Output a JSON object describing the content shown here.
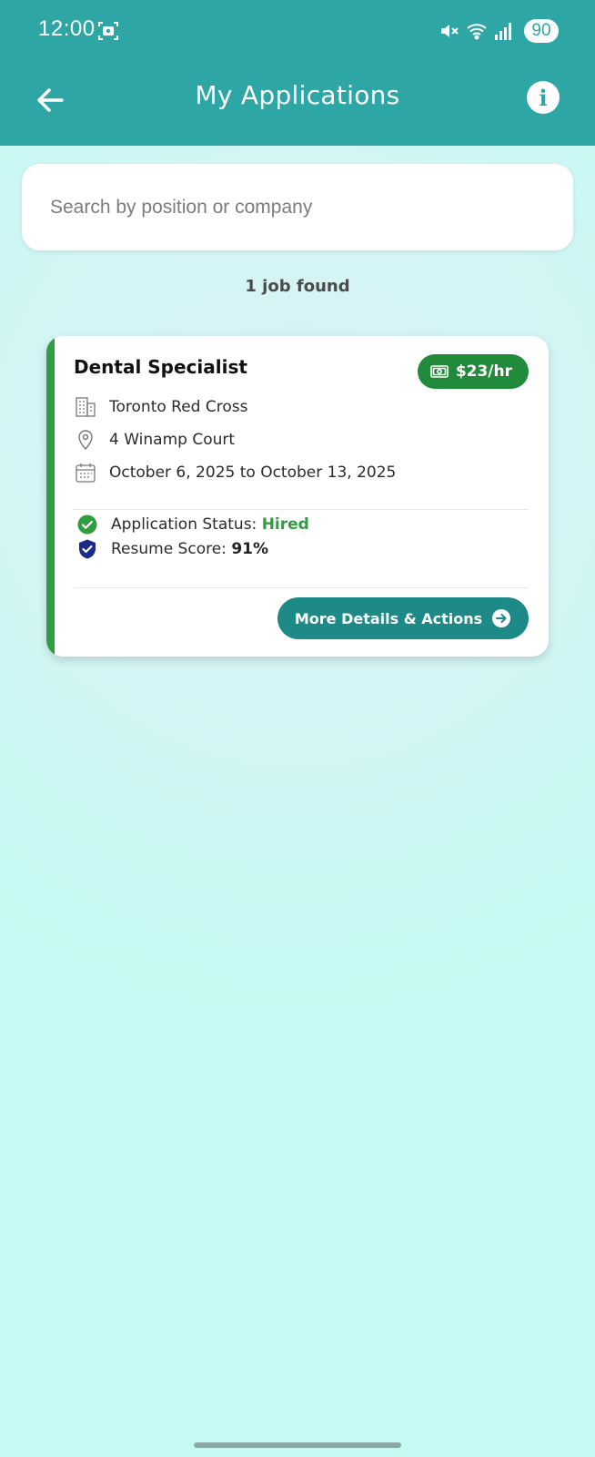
{
  "status_bar": {
    "time": "12:00",
    "battery": "90",
    "icons": [
      "screenshot-icon",
      "mute-icon",
      "wifi-icon",
      "signal-icon"
    ]
  },
  "app_bar": {
    "title": "My Applications",
    "back_icon": "arrow-left-icon",
    "info_icon": "info-icon",
    "info_glyph": "i"
  },
  "search": {
    "placeholder": "Search by position or company",
    "value": ""
  },
  "results": {
    "count_text": "1 job found"
  },
  "jobs": [
    {
      "title": "Dental Specialist",
      "pay": "$23/hr",
      "company": "Toronto Red Cross",
      "address": "4 Winamp Court",
      "dates": "October 6, 2025 to October 13, 2025",
      "status_label": "Application Status: ",
      "status_value": "Hired",
      "score_label": "Resume Score: ",
      "score_value": "91%",
      "action_label": "More Details & Actions"
    }
  ],
  "colors": {
    "primary": "#2ea6a6",
    "accent_green": "#2e9e3f",
    "badge_green": "#228b3b",
    "button_teal": "#1e8a87",
    "shield_navy": "#1c2a8c"
  }
}
